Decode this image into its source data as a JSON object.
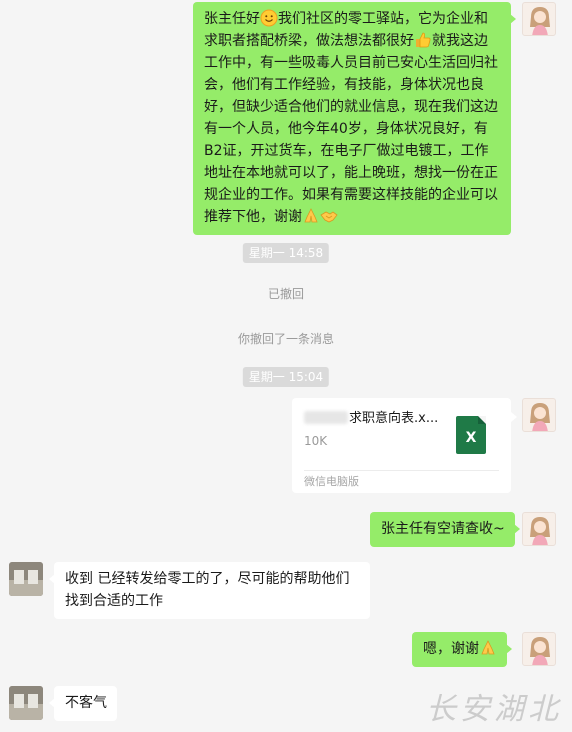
{
  "messages": {
    "m1": {
      "p1": "张主任好",
      "p2": "我们社区的零工驿站，它为企业和求职者搭配桥梁，做法想法都很好",
      "p3": "就我这边工作中，有一些吸毒人员目前已安心生活回归社会，他们有工作经验，有技能，身体状况也良好，但缺少适合他们的就业信息，现在我们这边有一个人员，他今年40岁，身体状况良好，有B2证，开过货车，在电子厂做过电镀工，工作地址在本地就可以了，能上晚班，想找一份在正规企业的工作。如果有需要这样技能的企业可以推荐下他，谢谢"
    },
    "m2": "张主任有空请查收~",
    "m3": "收到 已经转发给零工的了，尽可能的帮助他们找到合适的工作",
    "m4": "嗯，谢谢",
    "m5": "不客气"
  },
  "timestamps": {
    "t1": "星期一 14:58",
    "t2": "星期一 15:04"
  },
  "system": {
    "recalled1": "已撤回",
    "recalled2": "你撤回了一条消息"
  },
  "file": {
    "name_visible": "求职意向表.x...",
    "size": "10K",
    "source": "微信电脑版",
    "icon_letter": "X"
  },
  "icons": [
    "smile-emoji",
    "thumbs-up-emoji",
    "folded-hands-emoji",
    "handshake-emoji",
    "excel-file-icon"
  ],
  "colors": {
    "sent_bubble": "#95ec69",
    "received_bubble": "#ffffff",
    "background": "#f5f5f5",
    "excel": "#1f7a47"
  },
  "watermark": "长安湖北"
}
